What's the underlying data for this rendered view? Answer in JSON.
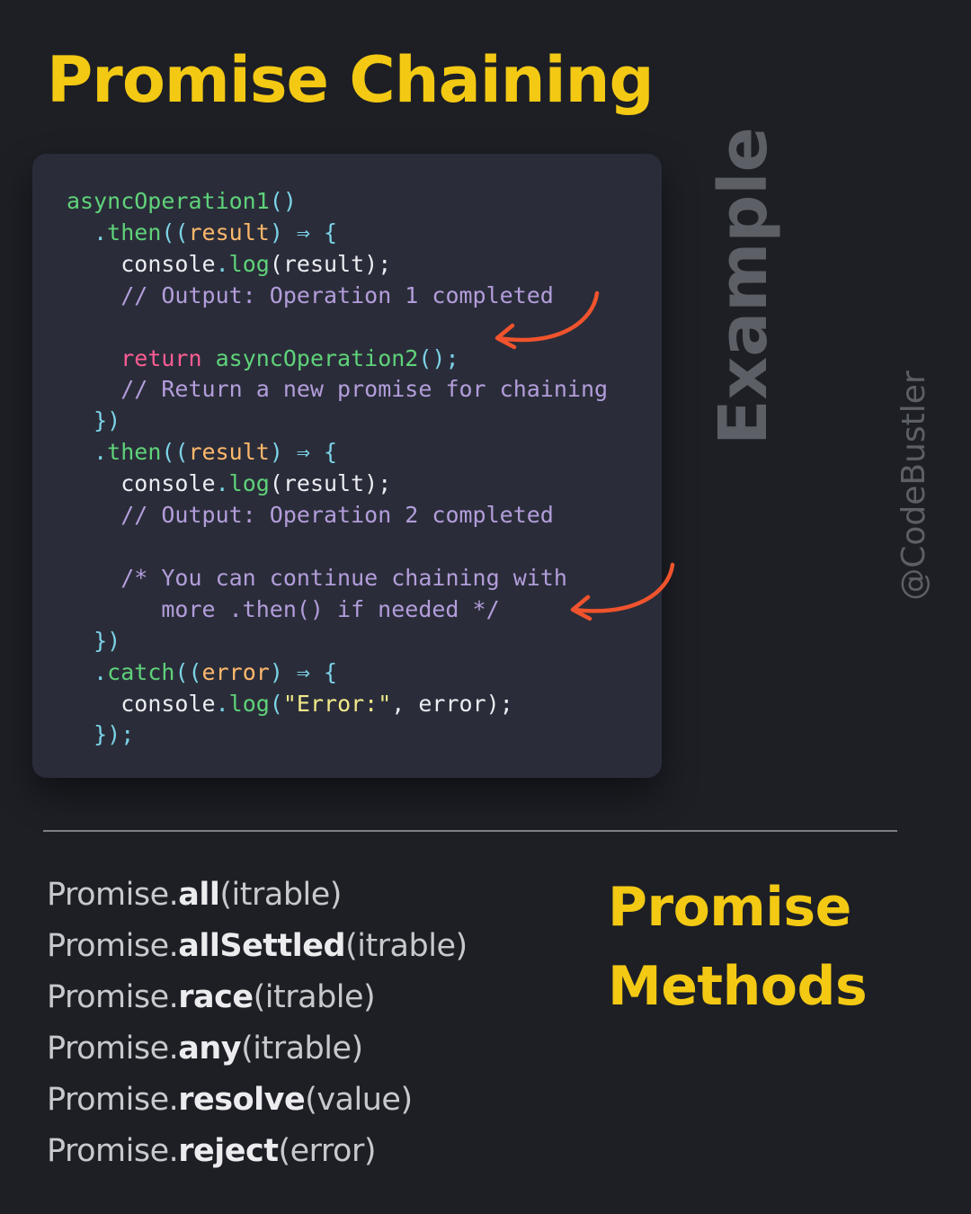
{
  "title": "Promise Chaining",
  "side_label": "Example",
  "handle": "@CodeBustler",
  "colors": {
    "background": "#1d1f25",
    "card": "#2a2d39",
    "accent_yellow": "#f3c913",
    "arrow": "#f0532d",
    "code_function": "#5fd27a",
    "code_method": "#7cd3e8",
    "code_param": "#ffb86c",
    "code_comment": "#b39ddb",
    "code_keyword": "#ff5c93",
    "code_string": "#f1e88a",
    "muted_label": "#5d5f66"
  },
  "code": {
    "l1_fn": "asyncOperation1",
    "l1_parens": "()",
    "l2_dot": ".",
    "l2_then": "then",
    "l2_open": "((",
    "l2_param": "result",
    "l2_close": ")",
    "l2_arrow": " ⇒ {",
    "l3_obj": "console",
    "l3_dot": ".",
    "l3_log": "log",
    "l3_args": "(result);",
    "l4_comment": "// Output: Operation 1 completed",
    "l6_kw": "return",
    "l6_fn": "asyncOperation2",
    "l6_tail": "();",
    "l7_comment": "// Return a new promise for chaining",
    "l8_close": "})",
    "l9_dot": ".",
    "l9_then": "then",
    "l9_open": "((",
    "l9_param": "result",
    "l9_close": ")",
    "l9_arrow": " ⇒ {",
    "l10_obj": "console",
    "l10_dot": ".",
    "l10_log": "log",
    "l10_args": "(result);",
    "l11_comment": "// Output: Operation 2 completed",
    "l13_comment": "/* You can continue chaining with",
    "l14_comment": "more .then() if needed */",
    "l15_close": "})",
    "l16_dot": ".",
    "l16_catch": "catch",
    "l16_open": "((",
    "l16_param": "error",
    "l16_close": ")",
    "l16_arrow": " ⇒ {",
    "l17_obj": "console",
    "l17_dot": ".",
    "l17_log": "log",
    "l17_open": "(",
    "l17_string": "\"Error:\"",
    "l17_tail": ", error);",
    "l18_close": "});"
  },
  "methods_title_line1": "Promise",
  "methods_title_line2": "Methods",
  "methods": [
    {
      "prefix": "Promise.",
      "name": "all",
      "args": "(itrable)"
    },
    {
      "prefix": "Promise.",
      "name": "allSettled",
      "args": "(itrable)"
    },
    {
      "prefix": "Promise.",
      "name": "race",
      "args": "(itrable)"
    },
    {
      "prefix": "Promise.",
      "name": "any",
      "args": "(itrable)"
    },
    {
      "prefix": "Promise.",
      "name": "resolve",
      "args": "(value)"
    },
    {
      "prefix": "Promise.",
      "name": "reject",
      "args": "(error)"
    }
  ]
}
